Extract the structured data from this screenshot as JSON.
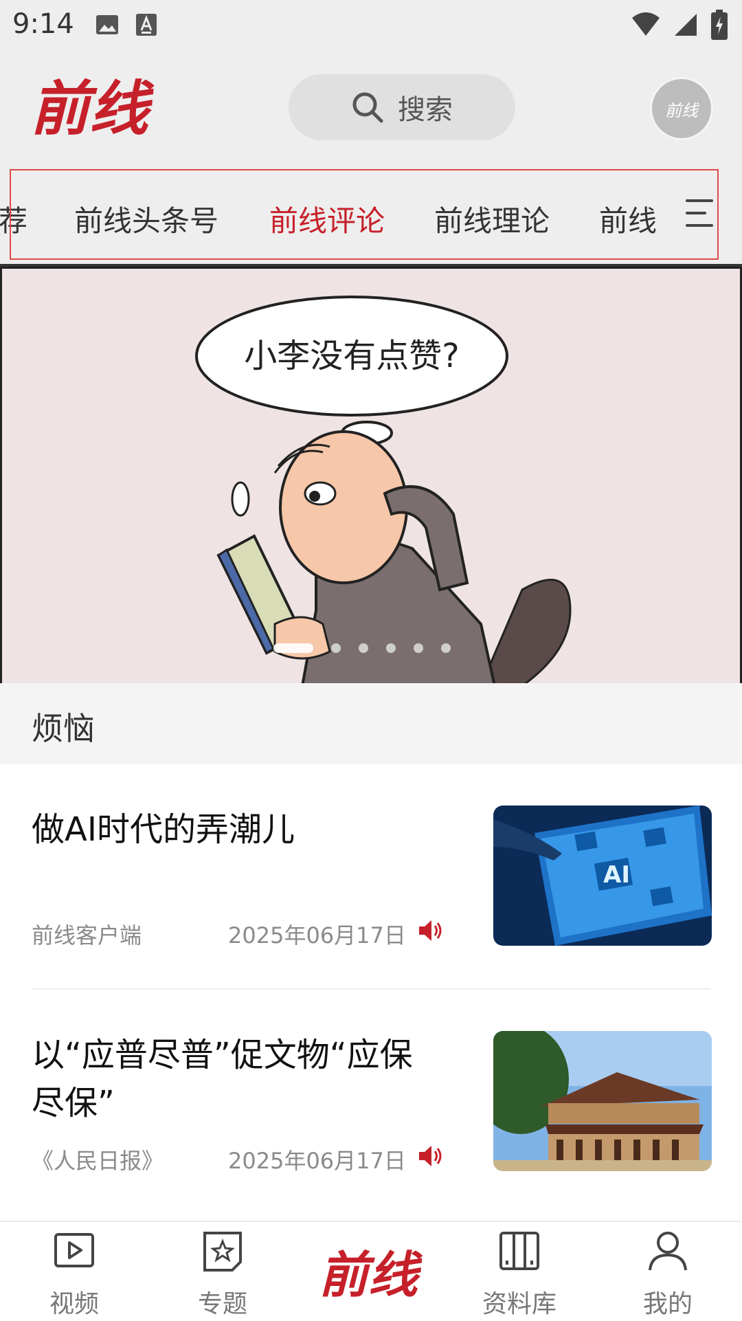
{
  "status_bar": {
    "time": "9:14"
  },
  "header": {
    "logo_text": "前线",
    "search_placeholder": "搜索",
    "avatar_text": "前线"
  },
  "tabs": [
    {
      "label": "荐"
    },
    {
      "label": "前线头条号"
    },
    {
      "label": "前线评论",
      "active": true
    },
    {
      "label": "前线理论"
    },
    {
      "label": "前线"
    }
  ],
  "banner": {
    "speech_text": "小李没有点赞?",
    "caption": "烦恼",
    "slide_count": 6,
    "active_slide": 1
  },
  "articles": [
    {
      "title": "做AI时代的弄潮儿",
      "source": "前线客户端",
      "date": "2025年06月17日"
    },
    {
      "title": "以“应普尽普”促文物“应保尽保”",
      "source": "《人民日报》",
      "date": "2025年06月17日"
    }
  ],
  "bottom_nav": [
    {
      "label": "视频",
      "icon": "play-icon"
    },
    {
      "label": "专题",
      "icon": "star-doc-icon"
    },
    {
      "label": "前线",
      "icon": "logo"
    },
    {
      "label": "资料库",
      "icon": "library-icon"
    },
    {
      "label": "我的",
      "icon": "user-icon"
    }
  ],
  "colors": {
    "accent": "#c6202a",
    "header_bg": "#eeeeee"
  }
}
